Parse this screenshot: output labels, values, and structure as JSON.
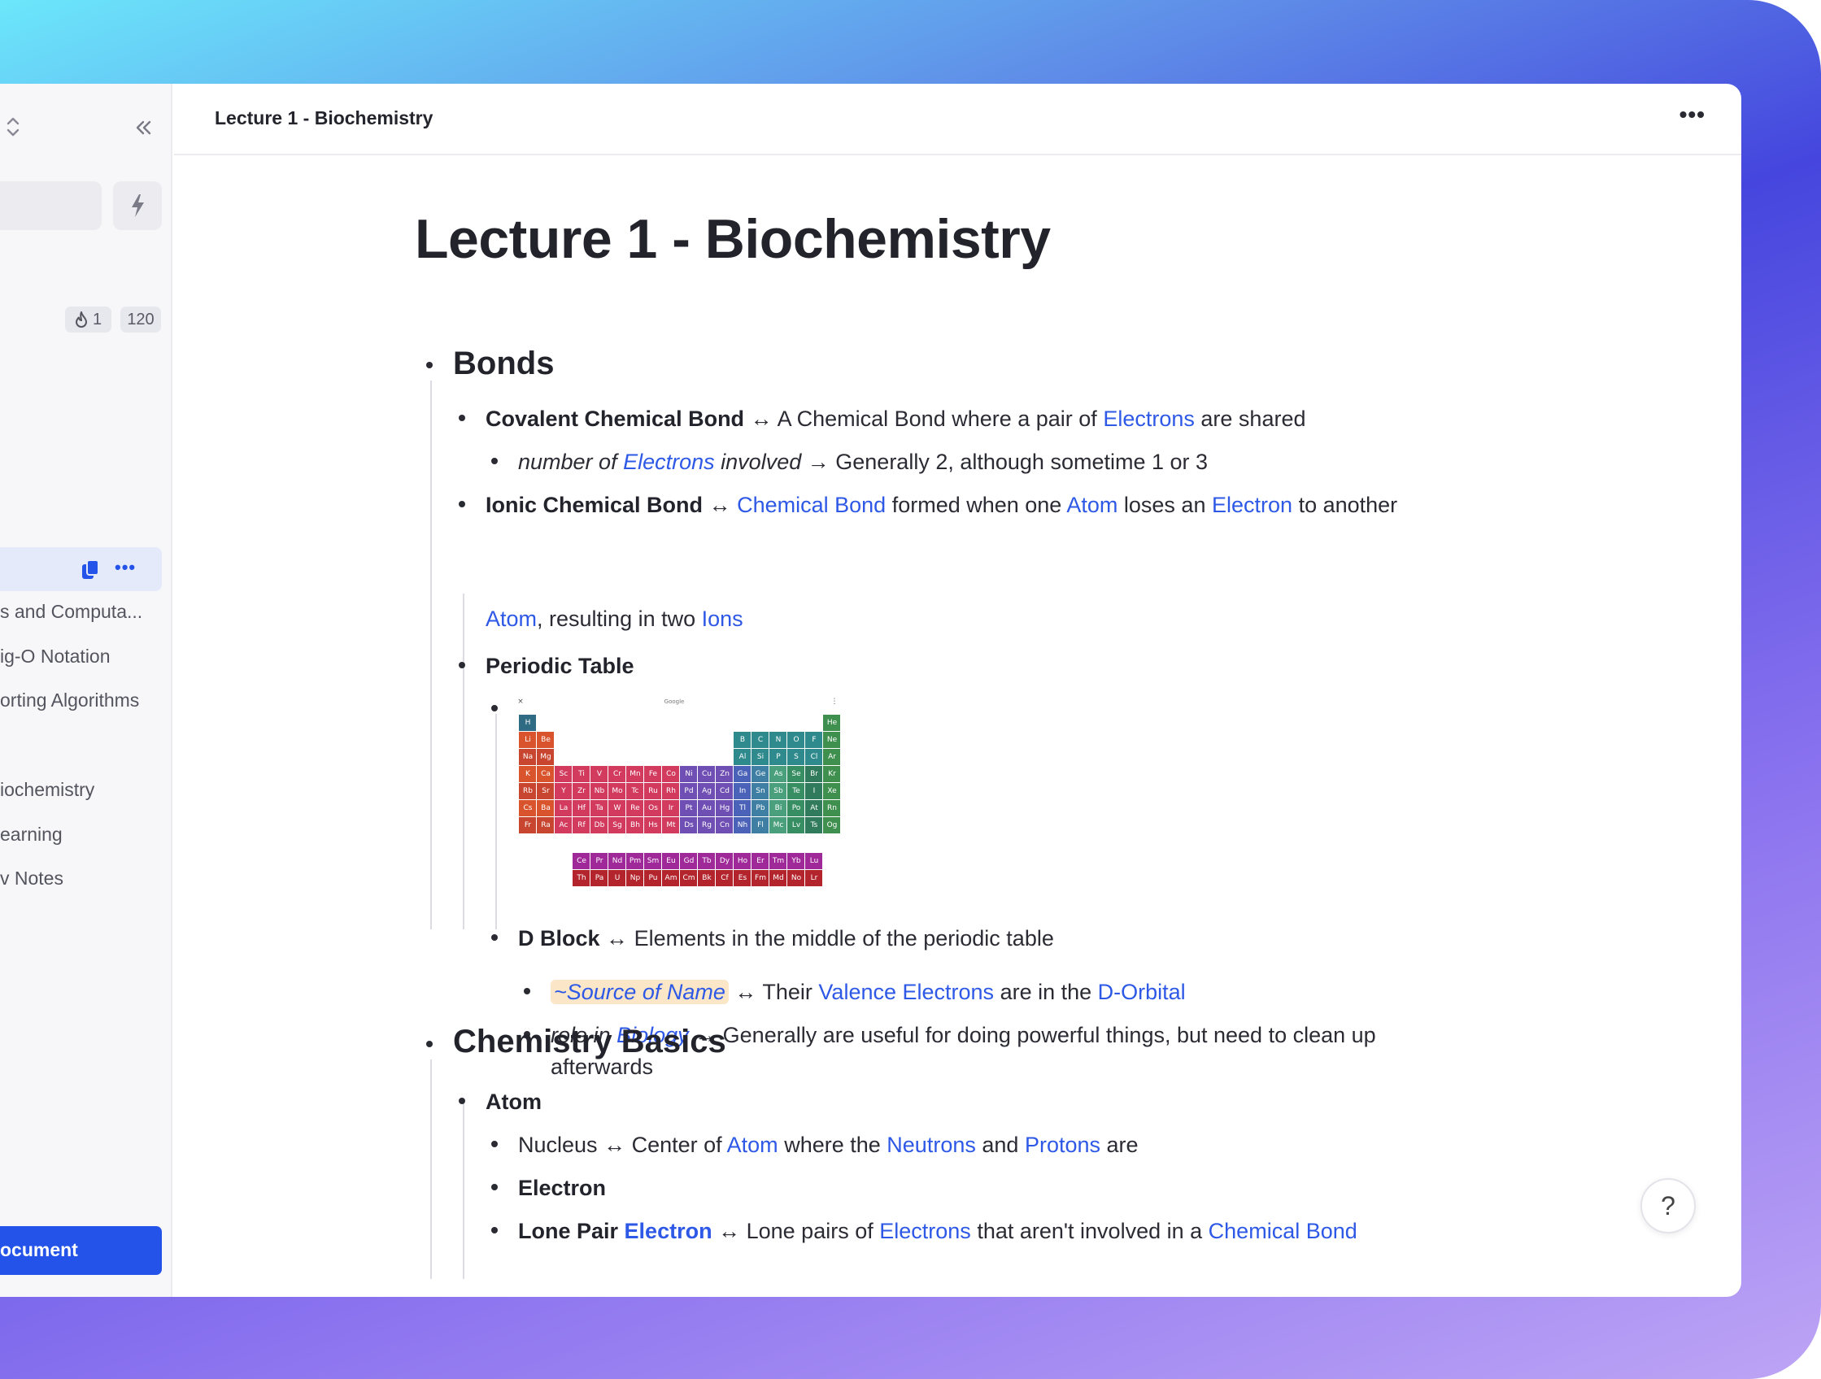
{
  "header": {
    "title": "Lecture 1 -  Biochemistry",
    "more_label": "•••"
  },
  "sidebar": {
    "chip_streak": "1",
    "chip_count": "120",
    "active_more": "•••",
    "items": [
      "s and Computa...",
      "ig-O Notation",
      "orting Algorithms",
      "iochemistry",
      "earning",
      "v Notes"
    ],
    "new_document_label": "ocument"
  },
  "doc": {
    "title": "Lecture 1 -  Biochemistry",
    "bonds": {
      "heading": "Bonds",
      "covalent": {
        "term": "Covalent Chemical Bond",
        "arrow": "↔",
        "text1": "A Chemical Bond where a pair of",
        "link": "Electrons",
        "text2": "are shared"
      },
      "covalent_sub": {
        "prop": "number of",
        "link": "Electrons",
        "prop2": "involved",
        "arrow": "→",
        "text": "Generally 2, although sometime 1 or 3"
      },
      "ionic": {
        "term": "Ionic Chemical Bond",
        "arrow": "↔",
        "link1": "Chemical Bond",
        "text1": "formed when one",
        "link2": "Atom",
        "text2": "loses an",
        "link3": "Electron",
        "text3": "to another",
        "link4": "Atom",
        "text4": ", resulting in two",
        "link5": "Ions"
      },
      "periodic": {
        "term": "Periodic Table"
      },
      "dblock": {
        "term": "D Block",
        "arrow": "↔",
        "text": "Elements in the middle of the periodic table"
      },
      "source": {
        "prop": "~Source of Name",
        "arrow": "↔",
        "text1": "Their",
        "link1": "Valence Electrons",
        "text2": "are in the",
        "link2": "D-Orbital"
      },
      "role": {
        "prop": "role in",
        "link": "Biology",
        "arrow": "→",
        "text1": "Generally are useful for doing powerful things, but need to clean up",
        "text2": "afterwards"
      }
    },
    "basics": {
      "heading": "Chemistry Basics",
      "atom": {
        "term": "Atom"
      },
      "nucleus": {
        "term": "Nucleus",
        "arrow": "↔",
        "text1": "Center of",
        "link1": "Atom",
        "text2": "where the",
        "link2": "Neutrons",
        "text3": "and",
        "link3": "Protons",
        "text4": "are"
      },
      "electron": {
        "term": "Electron"
      },
      "lone": {
        "term": "Lone Pair",
        "link0": "Electron",
        "arrow": "↔",
        "text1": "Lone pairs of",
        "link1": "Electrons",
        "text2": "that aren't involved in a",
        "link2": "Chemical Bond"
      }
    }
  },
  "periodic_image": {
    "top_left": "×",
    "top_center": "Google",
    "top_right": "⋮",
    "rows": [
      [
        "H",
        "",
        "",
        "",
        "",
        "",
        "",
        "",
        "",
        "",
        "",
        "",
        "",
        "",
        "",
        "",
        "",
        "He"
      ],
      [
        "Li",
        "Be",
        "",
        "",
        "",
        "",
        "",
        "",
        "",
        "",
        "",
        "",
        "B",
        "C",
        "N",
        "O",
        "F",
        "Ne"
      ],
      [
        "Na",
        "Mg",
        "",
        "",
        "",
        "",
        "",
        "",
        "",
        "",
        "",
        "",
        "Al",
        "Si",
        "P",
        "S",
        "Cl",
        "Ar"
      ],
      [
        "K",
        "Ca",
        "Sc",
        "Ti",
        "V",
        "Cr",
        "Mn",
        "Fe",
        "Co",
        "Ni",
        "Cu",
        "Zn",
        "Ga",
        "Ge",
        "As",
        "Se",
        "Br",
        "Kr"
      ],
      [
        "Rb",
        "Sr",
        "Y",
        "Zr",
        "Nb",
        "Mo",
        "Tc",
        "Ru",
        "Rh",
        "Pd",
        "Ag",
        "Cd",
        "In",
        "Sn",
        "Sb",
        "Te",
        "I",
        "Xe"
      ],
      [
        "Cs",
        "Ba",
        "La",
        "Hf",
        "Ta",
        "W",
        "Re",
        "Os",
        "Ir",
        "Pt",
        "Au",
        "Hg",
        "Tl",
        "Pb",
        "Bi",
        "Po",
        "At",
        "Rn"
      ],
      [
        "Fr",
        "Ra",
        "Ac",
        "Rf",
        "Db",
        "Sg",
        "Bh",
        "Hs",
        "Mt",
        "Ds",
        "Rg",
        "Cn",
        "Nh",
        "Fl",
        "Mc",
        "Lv",
        "Ts",
        "Og"
      ]
    ],
    "lanthanides": [
      "Ce",
      "Pr",
      "Nd",
      "Pm",
      "Sm",
      "Eu",
      "Gd",
      "Tb",
      "Dy",
      "Ho",
      "Er",
      "Tm",
      "Yb",
      "Lu"
    ],
    "actinides": [
      "Th",
      "Pa",
      "U",
      "Np",
      "Pu",
      "Am",
      "Cm",
      "Bk",
      "Cf",
      "Es",
      "Fm",
      "Md",
      "No",
      "Lr"
    ]
  },
  "help_label": "?",
  "colors": {
    "link": "#2e58e6",
    "accent_button": "#2453ea",
    "highlight": "#fbe7c8"
  }
}
